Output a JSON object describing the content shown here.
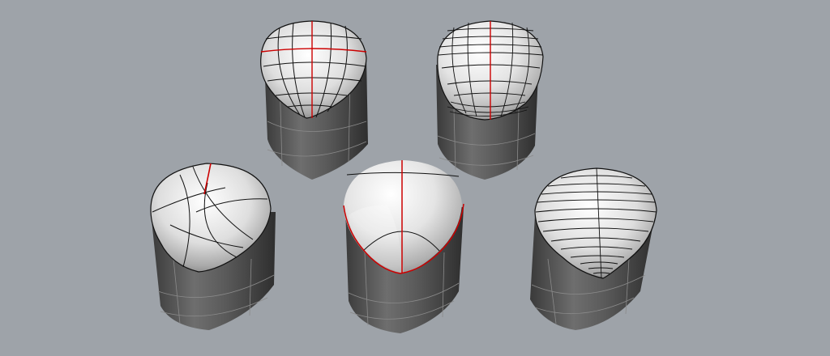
{
  "viewport": {
    "background": "#9ea3a9",
    "objects": [
      {
        "id": "shape-1",
        "topology": "isoparm-grid"
      },
      {
        "id": "shape-2",
        "topology": "dense-isoparm-grid"
      },
      {
        "id": "shape-3",
        "topology": "curved-patch"
      },
      {
        "id": "shape-4",
        "topology": "single-seam"
      },
      {
        "id": "shape-5",
        "topology": "concentric-lines"
      }
    ]
  },
  "colors": {
    "side_dark": "#3a3a3a",
    "side_mid": "#5b5b5b",
    "side_light": "#727272",
    "cap_light": "#f4f4f4",
    "cap_shadow": "#8e8e8e",
    "edge_highlight": "#cc0000",
    "wire": "#111111"
  }
}
